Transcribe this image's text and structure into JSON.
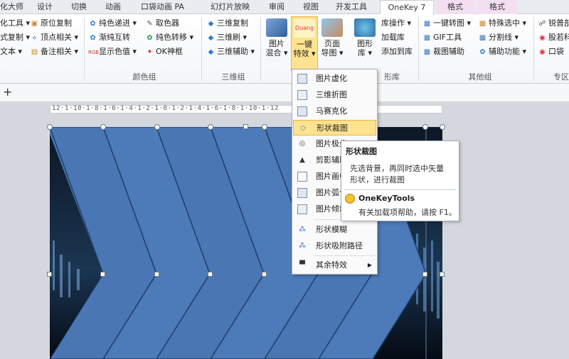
{
  "tabs": {
    "items": [
      "化大师",
      "设计",
      "切换",
      "动画",
      "口袋动画 PA",
      "幻灯片放映",
      "审阅",
      "视图",
      "开发工具",
      "OneKey 7",
      "格式",
      "格式"
    ]
  },
  "ribbon": {
    "col1": [
      "化工具",
      "式复制",
      "文本"
    ],
    "col2": [
      "原位复制",
      "顶点相关",
      "备注相关"
    ],
    "col3": [
      "纯色递进",
      "渐纯互转",
      "显示色值"
    ],
    "col4": [
      "取色器",
      "纯色转移",
      "OK神框"
    ],
    "col5": [
      "三维复制",
      "三维刷",
      "三维辅助"
    ],
    "big": [
      {
        "line1": "图片",
        "line2": "混合"
      },
      {
        "line1": "一键",
        "line2": "特效"
      },
      {
        "line1": "页面",
        "line2": "导图"
      },
      {
        "line1": "图形",
        "line2": "库"
      }
    ],
    "col6": [
      "库操作",
      "加载库",
      "添加到库"
    ],
    "col7": [
      "一键转图",
      "GIF工具",
      "裁图辅助"
    ],
    "col8": [
      "特殊选中",
      "分割线",
      "辅助功能"
    ],
    "col9": [
      "锐普部",
      "股若科",
      "口袋"
    ],
    "groups": [
      "颜色组",
      "三维组",
      "形库",
      "其他组",
      "专区"
    ],
    "duang": "Duang",
    "rgb": "RGB"
  },
  "menu": {
    "items": [
      "图片虚化",
      "三维折图",
      "马赛克化",
      "形状裁图",
      "图片极坐",
      "剪影辅助",
      "图片画中",
      "图片弧化",
      "图片倾斜",
      "形状模糊",
      "形状吸附路径",
      "其余特效"
    ]
  },
  "tooltip": {
    "title": "形状裁图",
    "desc1": "先选背景，再同时选中矢量",
    "desc2": "形状，进行裁图",
    "brand": "OneKeyTools",
    "help": "有关加载项帮助，请按 F1。"
  },
  "ruler": "12·1·10·1·8·1·6·1·4·1·2·1·0·1·2·1·4·1·6·1·8·1·10·1·12",
  "toolbar": {
    "plus": "+"
  },
  "colors": {
    "shape": "#4a77b4",
    "shape_line": "#1f3f6e",
    "highlight": "#fde38f",
    "tab_pink": "#f4dff0"
  }
}
